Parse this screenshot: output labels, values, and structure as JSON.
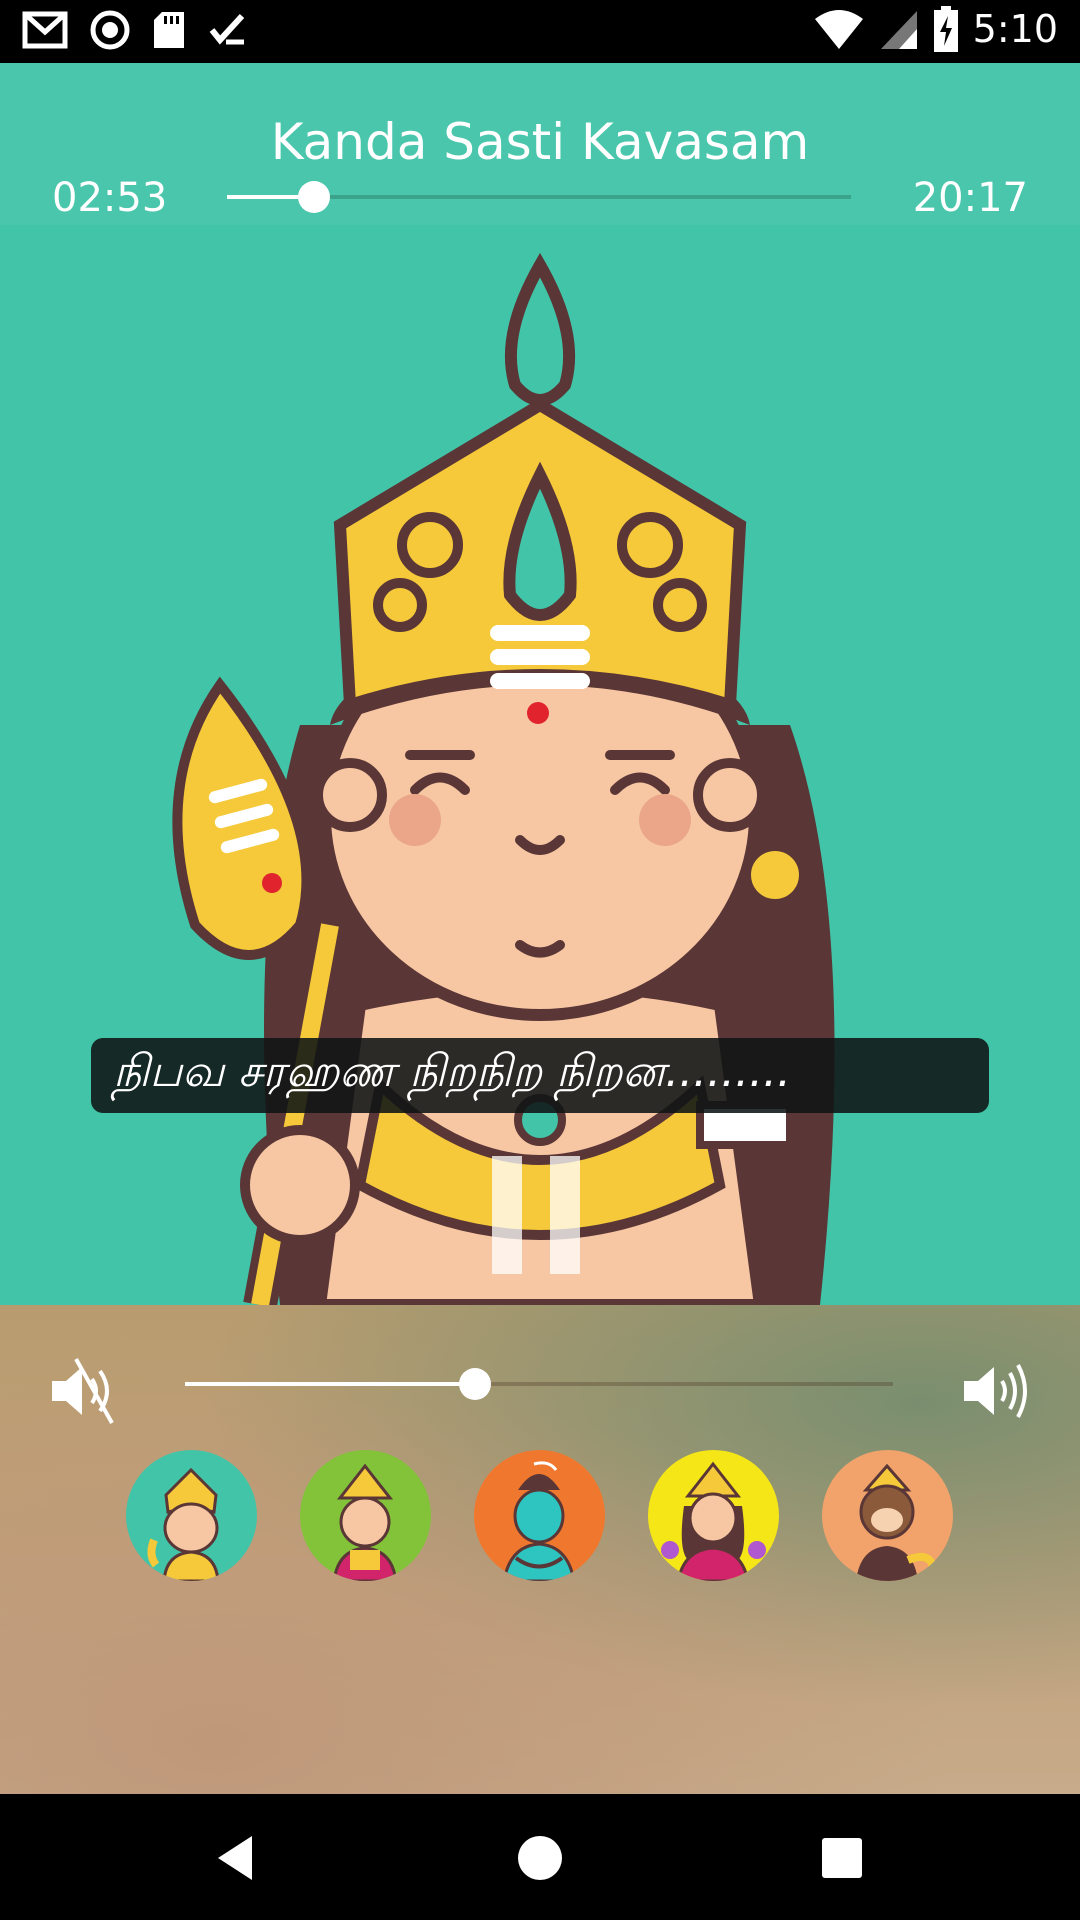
{
  "status_bar": {
    "time": "5:10",
    "left_icons": [
      "gmail-icon",
      "record-icon",
      "sd-card-icon",
      "checklist-icon"
    ],
    "right_icons": [
      "wifi-icon",
      "signal-icon",
      "battery-charging-icon"
    ]
  },
  "player": {
    "title": "Kanda Sasti Kavasam",
    "elapsed": "02:53",
    "total": "20:17",
    "progress": 0.14,
    "background_color": "#42C4A8",
    "lyrics": "நிபவ சரஹண நிறநிற நிறன.........",
    "play_state": "playing",
    "control_icon": "pause-icon"
  },
  "volume": {
    "level": 0.41,
    "min_icon": "volume-mute-icon",
    "max_icon": "volume-up-icon"
  },
  "deities": [
    {
      "name": "murugan-avatar",
      "bg": "#42C4A8"
    },
    {
      "name": "amman-avatar",
      "bg": "#82C33A"
    },
    {
      "name": "shiva-avatar",
      "bg": "#F0782E"
    },
    {
      "name": "lakshmi-avatar",
      "bg": "#F4E617"
    },
    {
      "name": "hanuman-avatar",
      "bg": "#F1A36B"
    }
  ],
  "nav_bar": {
    "icons": [
      "back-icon",
      "home-icon",
      "recents-icon"
    ]
  }
}
